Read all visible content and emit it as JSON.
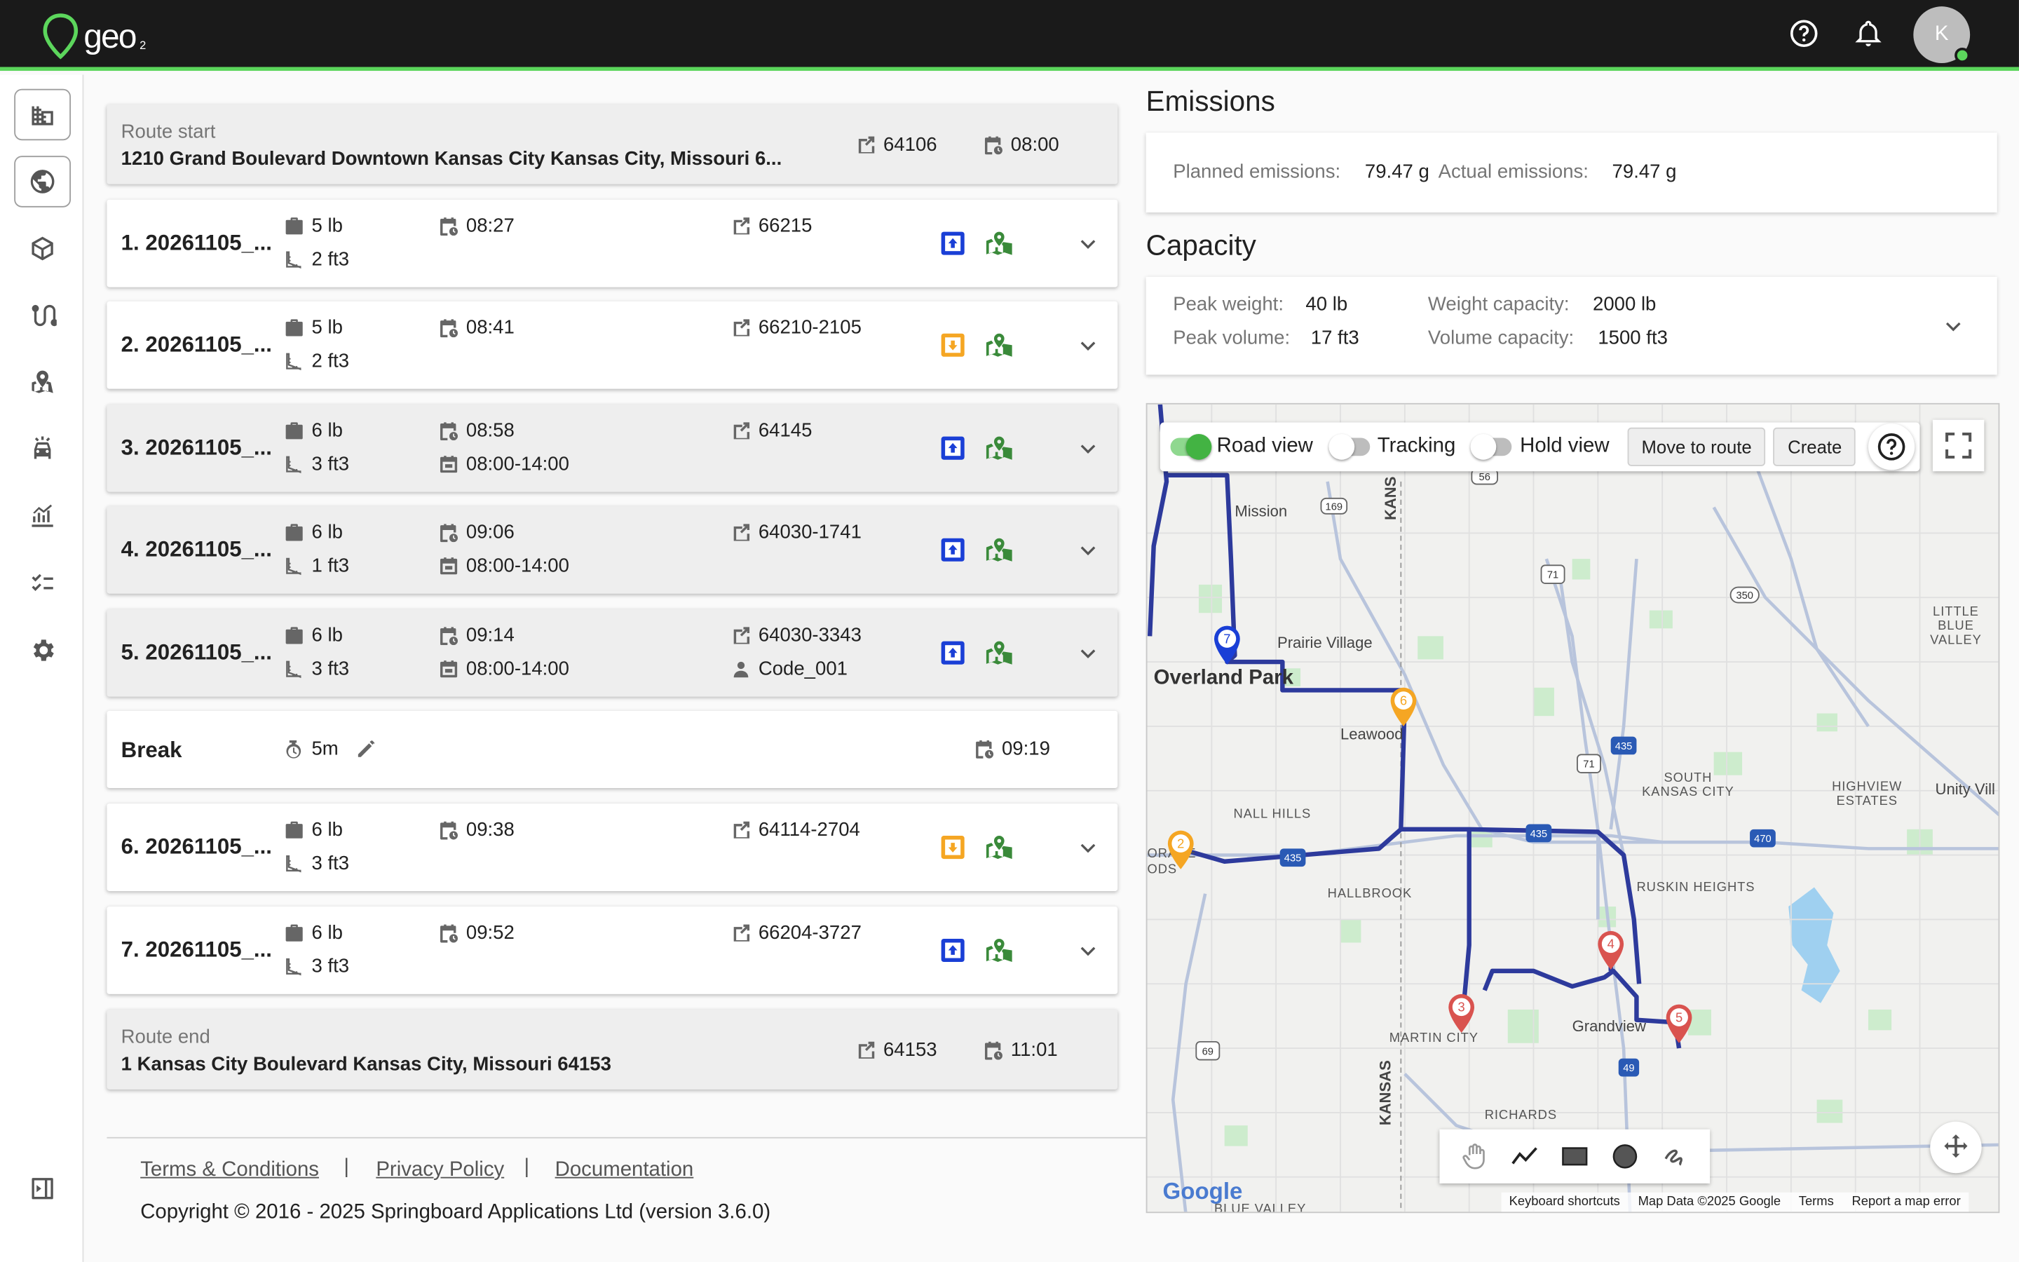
{
  "app": {
    "logo_text": "geo",
    "logo_sub": "2",
    "avatar_initial": "K"
  },
  "route_start": {
    "label": "Route start",
    "address": "1210 Grand Boulevard Downtown Kansas City Kansas City, Missouri 6...",
    "postcode": "64106",
    "time": "08:00"
  },
  "stops": [
    {
      "name": "1. 20261105_...",
      "weight": "5 lb",
      "volume": "2 ft3",
      "eta": "08:27",
      "window": "",
      "postcode": "66215",
      "code": "",
      "type": "delivery",
      "grey": false
    },
    {
      "name": "2. 20261105_...",
      "weight": "5 lb",
      "volume": "2 ft3",
      "eta": "08:41",
      "window": "",
      "postcode": "66210-2105",
      "code": "",
      "type": "pickup",
      "grey": false
    },
    {
      "name": "3. 20261105_...",
      "weight": "6 lb",
      "volume": "3 ft3",
      "eta": "08:58",
      "window": "08:00-14:00",
      "postcode": "64145",
      "code": "",
      "type": "delivery",
      "grey": true
    },
    {
      "name": "4. 20261105_...",
      "weight": "6 lb",
      "volume": "1 ft3",
      "eta": "09:06",
      "window": "08:00-14:00",
      "postcode": "64030-1741",
      "code": "",
      "type": "delivery",
      "grey": true
    },
    {
      "name": "5. 20261105_...",
      "weight": "6 lb",
      "volume": "3 ft3",
      "eta": "09:14",
      "window": "08:00-14:00",
      "postcode": "64030-3343",
      "code": "Code_001",
      "type": "delivery",
      "grey": true
    },
    {
      "name": "6. 20261105_...",
      "weight": "6 lb",
      "volume": "3 ft3",
      "eta": "09:38",
      "window": "",
      "postcode": "64114-2704",
      "code": "",
      "type": "pickup",
      "grey": false
    },
    {
      "name": "7. 20261105_...",
      "weight": "6 lb",
      "volume": "3 ft3",
      "eta": "09:52",
      "window": "",
      "postcode": "66204-3727",
      "code": "",
      "type": "delivery",
      "grey": false
    }
  ],
  "break": {
    "label": "Break",
    "duration": "5m",
    "time": "09:19"
  },
  "route_end": {
    "label": "Route end",
    "address": "1 Kansas City Boulevard Kansas City, Missouri 64153",
    "postcode": "64153",
    "time": "11:01"
  },
  "emissions": {
    "title": "Emissions",
    "planned_label": "Planned emissions:",
    "planned_value": "79.47 g",
    "actual_label": "Actual emissions:",
    "actual_value": "79.47 g"
  },
  "capacity": {
    "title": "Capacity",
    "peak_weight_label": "Peak weight:",
    "peak_weight_value": "40 lb",
    "peak_volume_label": "Peak volume:",
    "peak_volume_value": "17 ft3",
    "weight_cap_label": "Weight capacity:",
    "weight_cap_value": "2000 lb",
    "volume_cap_label": "Volume capacity:",
    "volume_cap_value": "1500 ft3"
  },
  "map": {
    "toolbar": {
      "road_view": "Road view",
      "road_view_on": true,
      "tracking": "Tracking",
      "tracking_on": false,
      "hold_view": "Hold view",
      "hold_view_on": false,
      "move_to_route": "Move to route",
      "create": "Create"
    },
    "labels": [
      "Mission",
      "Prairie Village",
      "Overland Park",
      "Leawood",
      "NALL HILLS",
      "HALLBROOK",
      "SOUTH KANSAS CITY",
      "HIGHVIEW ESTATES",
      "RUSKIN HEIGHTS",
      "Grandview",
      "MARTIN CITY",
      "RICHARDS",
      "LITTLE BLUE VALLEY",
      "Unity Vill",
      "KANSAS",
      "KANS",
      "BLUE VALLEY",
      "ORADE",
      "ODS"
    ],
    "shields": [
      "169",
      "56",
      "71",
      "350",
      "435",
      "71",
      "435",
      "470",
      "435",
      "49",
      "69"
    ],
    "markers": [
      "7",
      "6",
      "2",
      "3",
      "4",
      "5"
    ],
    "attribution": {
      "google": "Google",
      "shortcuts": "Keyboard shortcuts",
      "data": "Map Data ©2025 Google",
      "terms": "Terms",
      "report": "Report a map error"
    }
  },
  "footer": {
    "terms": "Terms & Conditions",
    "privacy": "Privacy Policy",
    "docs": "Documentation",
    "sep": "|",
    "copyright": "Copyright © 2016 - 2025 Springboard Applications Ltd (version 3.6.0)"
  },
  "colors": {
    "accent_green": "#5cd65c",
    "route_blue": "#2d3a9c",
    "delivery_blue": "#1a3fd6",
    "pickup_orange": "#f5a623",
    "map_icon_green": "#3a8a3a"
  }
}
